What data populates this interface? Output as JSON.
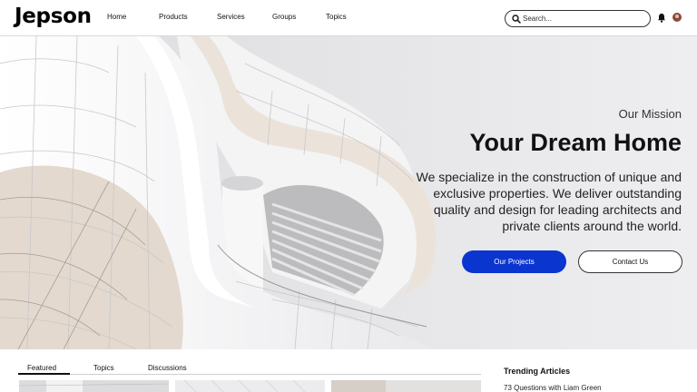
{
  "brand": {
    "logo": "Jepson"
  },
  "nav": {
    "items": [
      {
        "label": "Home"
      },
      {
        "label": "Products"
      },
      {
        "label": "Services"
      },
      {
        "label": "Groups"
      },
      {
        "label": "Topics"
      }
    ]
  },
  "search": {
    "placeholder": "Search..."
  },
  "header_icons": {
    "notifications": "bell-icon",
    "profile": "avatar"
  },
  "hero": {
    "label": "Our Mission",
    "title": "Your Dream Home",
    "description": "We specialize in the construction of unique and exclusive properties.  We deliver outstanding quality and design for leading architects and private clients around the world.",
    "primary_button": "Our Projects",
    "secondary_button": "Contact Us",
    "primary_color": "#0a35cf"
  },
  "tabs": {
    "items": [
      {
        "label": "Featured"
      },
      {
        "label": "Topics"
      },
      {
        "label": "Discussions"
      }
    ],
    "active": "Featured"
  },
  "trending": {
    "title": "Trending Articles",
    "items": [
      {
        "label": "73 Questions with Liam Green"
      }
    ]
  }
}
